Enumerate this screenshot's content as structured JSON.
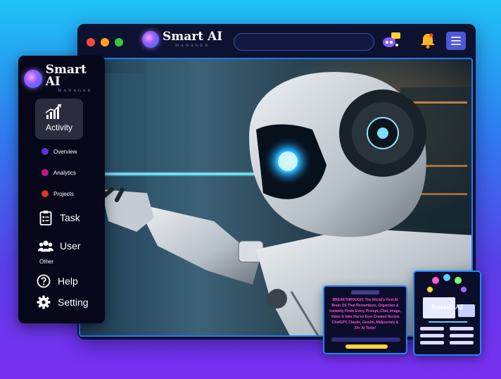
{
  "app": {
    "brand_title": "Smart AI",
    "brand_subtitle": "MANAGER"
  },
  "window": {
    "traffic_lights": [
      "#ff4a3d",
      "#ffa11a",
      "#39c83a"
    ],
    "toolbar_icons": [
      "chat-bot-icon",
      "bell-icon",
      "menu-icon"
    ]
  },
  "sidebar": {
    "active_item": {
      "label": "Activity",
      "icon": "chart-icon"
    },
    "sub_items": [
      {
        "label": "Overview",
        "color": "#5a35d8"
      },
      {
        "label": "Analytics",
        "color": "#c2178a"
      },
      {
        "label": "Projects",
        "color": "#e5311f"
      }
    ],
    "items": [
      {
        "label": "Task",
        "icon": "clipboard-icon"
      },
      {
        "label": "User",
        "icon": "users-icon"
      }
    ],
    "section_label": "Other",
    "other_items": [
      {
        "label": "Help",
        "icon": "help-icon"
      },
      {
        "label": "Setting",
        "icon": "gear-icon"
      }
    ]
  },
  "promo": {
    "headline": "BREAKTHROUGH: The World's First AI Brain OS That Remembers, Organizes & Instantly Finds Every Prompt, Chat, Image, Video & Idea You've Ever Created Across ChatGPT, Claude, Gemini, Midjourney & 20+ AI Tools!",
    "card_title": "Smart AI"
  }
}
